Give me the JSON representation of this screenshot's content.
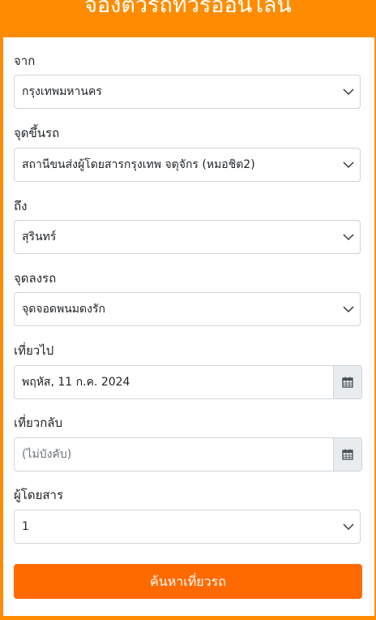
{
  "header": {
    "title": "จองตั๋วรถทัวร์ออนไลน์"
  },
  "form": {
    "from": {
      "label": "จาก",
      "value": "กรุงเทพมหานคร"
    },
    "boarding": {
      "label": "จุดขึ้นรถ",
      "value": "สถานีขนส่งผู้โดยสารกรุงเทพ จตุจักร (หมอชิต2)"
    },
    "to": {
      "label": "ถึง",
      "value": "สุรินทร์"
    },
    "dropoff": {
      "label": "จุดลงรถ",
      "value": "จุดจอดพนมดงรัก"
    },
    "depart": {
      "label": "เที่ยวไป",
      "value": "พฤหัส, 11 ก.ค. 2024"
    },
    "return": {
      "label": "เที่ยวกลับ",
      "placeholder": "(ไม่บังคับ)"
    },
    "passengers": {
      "label": "ผู้โดยสาร",
      "value": "1"
    },
    "search_button": "ค้นหาเที่ยวรถ"
  },
  "colors": {
    "brand": "#ff8c00",
    "button": "#ff6a00"
  },
  "icons": [
    "chevron-down-icon",
    "calendar-icon"
  ]
}
